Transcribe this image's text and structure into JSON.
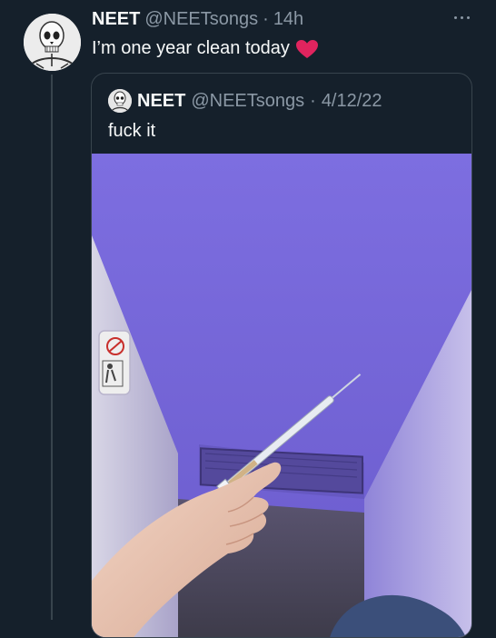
{
  "tweet": {
    "author_name": "NEET",
    "handle": "@NEETsongs",
    "separator": "·",
    "time": "14h",
    "text": "I’m one year clean today",
    "emoji": "red-heart"
  },
  "quote": {
    "author_name": "NEET",
    "handle": "@NEETsongs",
    "separator": "·",
    "date": "4/12/22",
    "text": "fuck it"
  },
  "colors": {
    "background": "#15202b",
    "muted": "#8b98a5",
    "border": "#38444d",
    "heart": "#e0245e"
  }
}
